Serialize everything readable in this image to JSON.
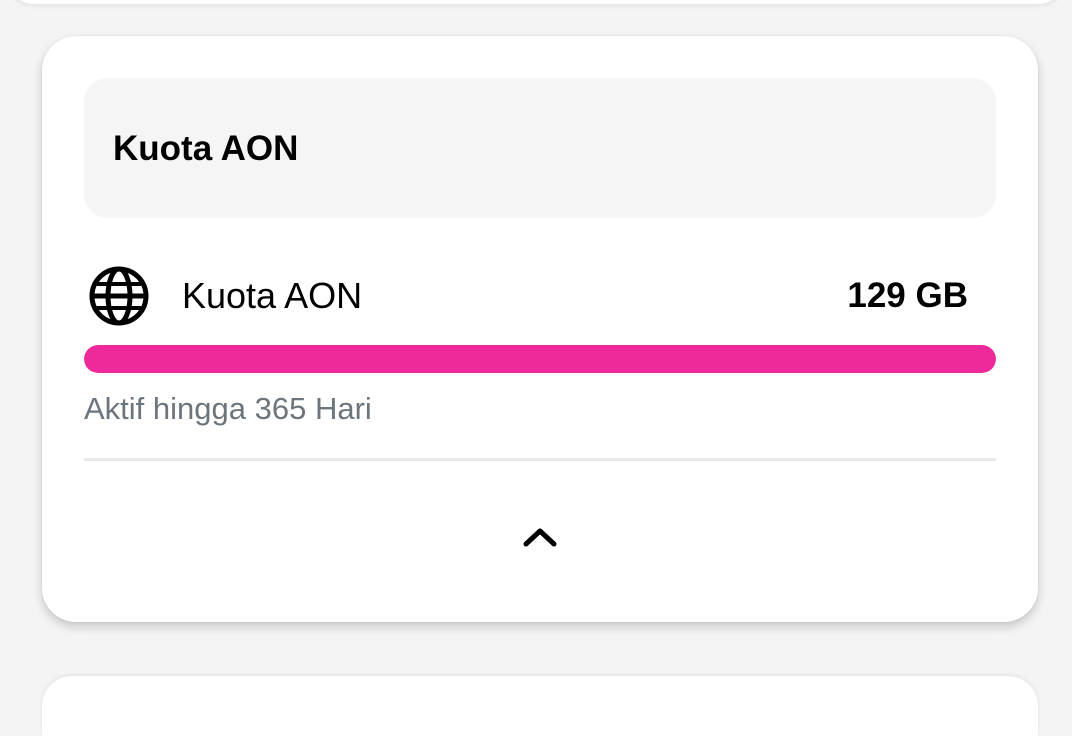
{
  "header": {
    "title": "Kuota AON"
  },
  "quota": {
    "icon": "globe-icon",
    "label": "Kuota AON",
    "amount": "129 GB",
    "progress_fraction": 1.0,
    "progress_color": "#ee299c",
    "validity": "Aktif hingga 365 Hari"
  },
  "collapse": {
    "icon": "chevron-up-icon"
  }
}
